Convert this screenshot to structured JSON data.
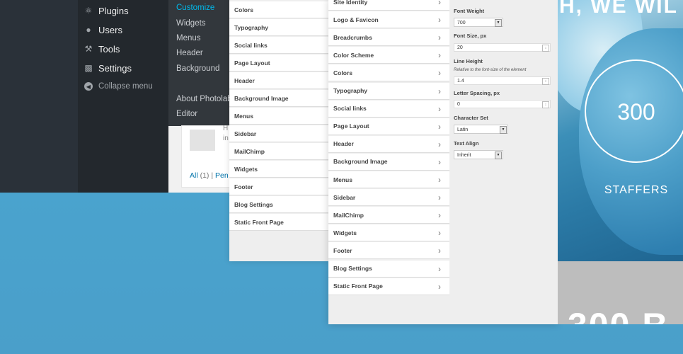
{
  "wp_menu": {
    "items": [
      {
        "label": "Plugins",
        "icon": "plugin-icon"
      },
      {
        "label": "Users",
        "icon": "user-icon"
      },
      {
        "label": "Tools",
        "icon": "wrench-icon"
      },
      {
        "label": "Settings",
        "icon": "settings-icon"
      }
    ],
    "collapse_label": "Collapse menu"
  },
  "wp_submenu": {
    "items": [
      "Customize",
      "Widgets",
      "Menus",
      "Header",
      "Background",
      "About Photolab",
      "Editor"
    ],
    "active": "Customize"
  },
  "wp_content": {
    "trunc1": "H",
    "trunc2": "in",
    "link_all": "All",
    "count_all": "(1)",
    "link_pending": "Pen",
    "separator": "|"
  },
  "panel1": {
    "items": [
      "Colors",
      "Typography",
      "Social links",
      "Page Layout",
      "Header",
      "Background Image",
      "Menus",
      "Sidebar",
      "MailChimp",
      "Widgets",
      "Footer",
      "Blog Settings",
      "Static Front Page"
    ]
  },
  "panel2": {
    "items": [
      "Site Identity",
      "Logo & Favicon",
      "Breadcrumbs",
      "Color Scheme",
      "Colors",
      "Typography",
      "Social links",
      "Page Layout",
      "Header",
      "Background Image",
      "Menus",
      "Sidebar",
      "MailChimp",
      "Widgets",
      "Footer",
      "Blog Settings",
      "Static Front Page"
    ]
  },
  "controls": {
    "font_weight": {
      "label": "Font Weight",
      "value": "700"
    },
    "font_size": {
      "label": "Font Size, px",
      "value": "20"
    },
    "line_height": {
      "label": "Line Height",
      "note": "Relative to the font-size of the element",
      "value": "1.4"
    },
    "letter_spacing": {
      "label": "Letter Spacing, px",
      "value": "0"
    },
    "charset": {
      "label": "Character Set",
      "value": "Latin"
    },
    "text_align": {
      "label": "Text Align",
      "value": "Inherit"
    }
  },
  "preview": {
    "headline": "H, WE WIL",
    "stat_number": "300",
    "stat_label": "STAFFERS",
    "bottom_partial": "300 B"
  },
  "colors": {
    "accent": "#00b9eb",
    "background": "#4aa3cc"
  }
}
